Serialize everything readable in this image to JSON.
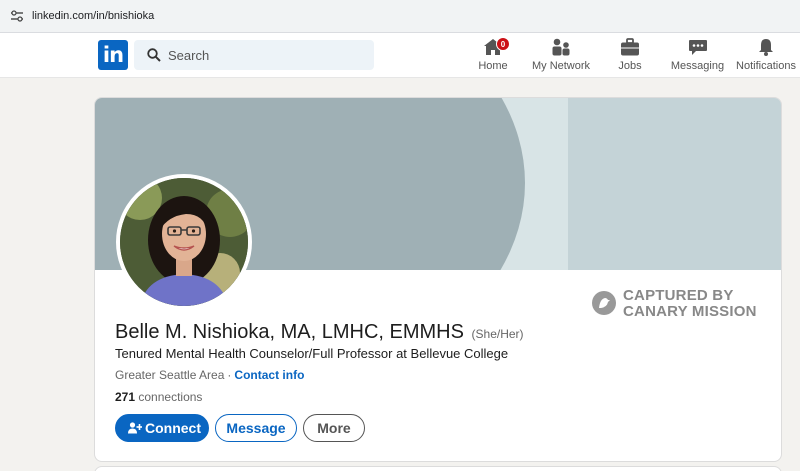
{
  "browser": {
    "url": "linkedin.com/in/bnishioka"
  },
  "nav": {
    "search_placeholder": "Search",
    "items": [
      {
        "label": "Home",
        "icon": "home-icon",
        "badge": "0"
      },
      {
        "label": "My Network",
        "icon": "network-icon"
      },
      {
        "label": "Jobs",
        "icon": "briefcase-icon"
      },
      {
        "label": "Messaging",
        "icon": "chat-icon"
      },
      {
        "label": "Notifications",
        "icon": "bell-icon"
      }
    ]
  },
  "profile": {
    "name": "Belle M. Nishioka, MA, LMHC, EMMHS",
    "pronouns": "(She/Her)",
    "headline": "Tenured Mental Health Counselor/Full Professor at Bellevue College",
    "location": "Greater Seattle Area",
    "separator": "·",
    "contact_info": "Contact info",
    "connections_count": "271",
    "connections_label": "connections"
  },
  "actions": {
    "connect": "Connect",
    "message": "Message",
    "more": "More"
  },
  "watermark": {
    "line1": "CAPTURED BY",
    "line2": "CANARY MISSION"
  },
  "colors": {
    "brand": "#0a66c2",
    "badge": "#cc1016",
    "banner_arc": "#9fb0b5",
    "banner_panel": "#c4d3d7"
  }
}
